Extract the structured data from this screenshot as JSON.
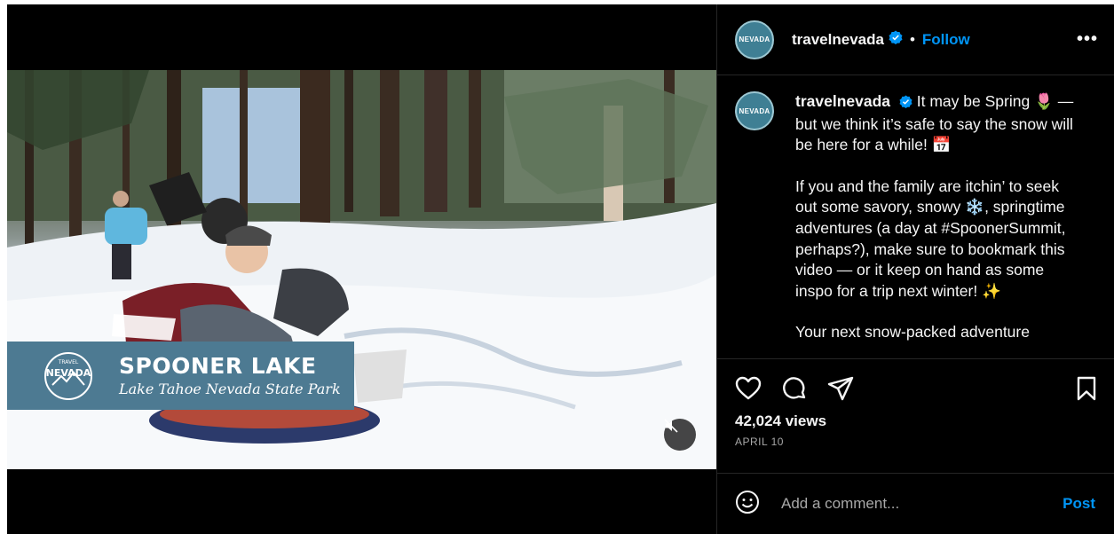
{
  "video": {
    "overlay_title": "SPOONER LAKE",
    "overlay_subtitle": "Lake Tahoe Nevada State Park",
    "logo_text_top": "TRAVEL",
    "logo_text_main": "NEVADA",
    "mute_icon": "speaker-muted-icon"
  },
  "header": {
    "username": "travelnevada",
    "separator": "•",
    "follow_label": "Follow",
    "more_label": "•••",
    "avatar_text": "NEVADA"
  },
  "caption": {
    "username": "travelnevada",
    "paragraphs": [
      "It may be Spring 🌷 — but we think it’s safe to say the snow will be here for a while! 📅",
      "If you and the family are itchin’ to seek out some savory, snowy ❄️, springtime adventures (a day at #SpoonerSummit, perhaps?), make sure to bookmark this video — or it keep on hand as some inspo for a trip next winter! ✨",
      "Your next snow-packed adventure"
    ]
  },
  "actions": {
    "icons": [
      "heart-icon",
      "comment-icon",
      "share-icon",
      "bookmark-icon"
    ],
    "views": "42,024 views",
    "date": "APRIL 10"
  },
  "comment": {
    "placeholder": "Add a comment...",
    "post_label": "Post"
  },
  "colors": {
    "background": "#000000",
    "accent": "#0095f6",
    "overlay": "#4d7a92",
    "muted_text": "#a8a8a8"
  }
}
